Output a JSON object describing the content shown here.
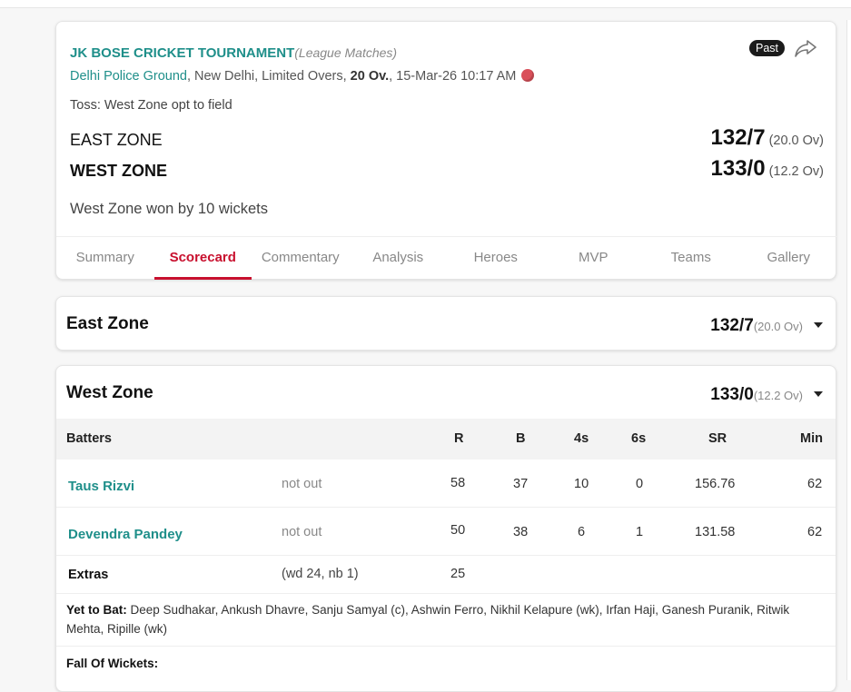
{
  "match": {
    "tournament": "JK BOSE CRICKET TOURNAMENT",
    "stage": "(League Matches)",
    "ground": "Delhi Police Ground",
    "city": ", New Delhi, Limited Overs, ",
    "overs": "20 Ov.",
    "datetime": ", 15-Mar-26 10:17 AM",
    "status_badge": "Past",
    "toss": "Toss: West Zone opt to field",
    "teams": [
      {
        "name": "EAST ZONE",
        "score": "132/7",
        "overs": "(20.0 Ov)"
      },
      {
        "name": "WEST ZONE",
        "score": "133/0",
        "overs": "(12.2 Ov)"
      }
    ],
    "result": "West Zone won by 10 wickets",
    "tabs": [
      "Summary",
      "Scorecard",
      "Commentary",
      "Analysis",
      "Heroes",
      "MVP",
      "Teams",
      "Gallery"
    ],
    "active_tab": "Scorecard"
  },
  "innings": [
    {
      "team": "East Zone",
      "score": "132/7",
      "overs": "(20.0 Ov)"
    },
    {
      "team": "West Zone",
      "score": "133/0",
      "overs": "(12.2 Ov)"
    }
  ],
  "batting": {
    "headers": {
      "batters": "Batters",
      "r": "R",
      "b": "B",
      "fours": "4s",
      "sixes": "6s",
      "sr": "SR",
      "min": "Min"
    },
    "rows": [
      {
        "name": "Taus Rizvi",
        "status": "not out",
        "r": "58",
        "b": "37",
        "fours": "10",
        "sixes": "0",
        "sr": "156.76",
        "min": "62"
      },
      {
        "name": "Devendra Pandey",
        "status": "not out",
        "r": "50",
        "b": "38",
        "fours": "6",
        "sixes": "1",
        "sr": "131.58",
        "min": "62"
      }
    ],
    "extras": {
      "label": "Extras",
      "detail": "(wd 24, nb 1)",
      "total": "25"
    },
    "yet_to_bat_label": "Yet to Bat:",
    "yet_to_bat": "Deep Sudhakar, Ankush Dhavre, Sanju Samyal (c), Ashwin Ferro, Nikhil Kelapure (wk), Irfan Haji, Ganesh Puranik, Ritwik Mehta, Ripille (wk)",
    "fall_of_wickets_label": "Fall Of Wickets:"
  },
  "colors": {
    "accent": "#c8102e",
    "link": "#1f8f8a",
    "badge": "#1b1b1b"
  }
}
